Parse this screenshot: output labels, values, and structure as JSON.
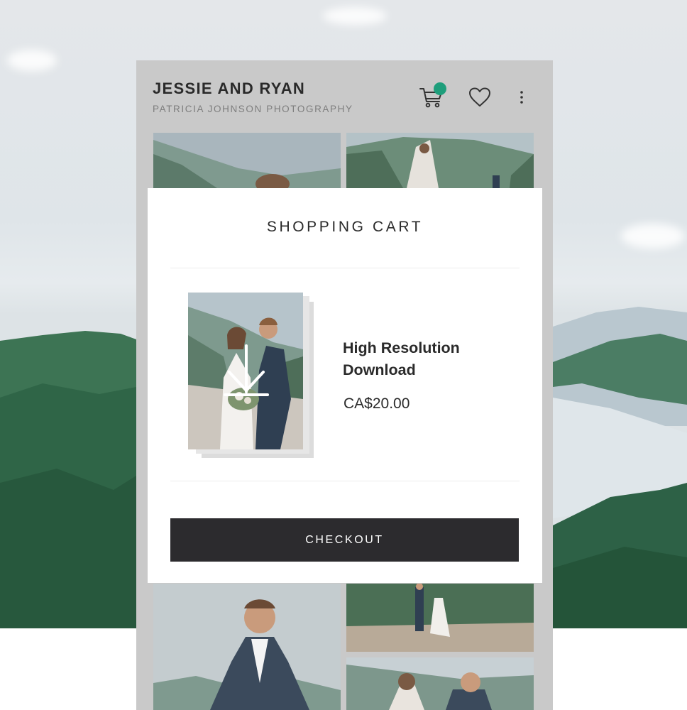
{
  "gallery": {
    "title": "JESSIE AND RYAN",
    "subtitle": "PATRICIA JOHNSON PHOTOGRAPHY",
    "icons": [
      "cart-icon",
      "heart-icon",
      "more-vertical-icon"
    ]
  },
  "cart": {
    "title": "SHOPPING CART",
    "item": {
      "name": "High Resolution Download",
      "price": "CA$20.00",
      "overlay_icon": "download-arrow-icon"
    },
    "checkout_label": "CHECKOUT"
  },
  "colors": {
    "badge": "#1e9e7b",
    "checkout_button": "#2c2b2e",
    "frame": "#c9c9c9",
    "title_text": "#2a2a2a",
    "subtitle_text": "#7d7d7d"
  }
}
